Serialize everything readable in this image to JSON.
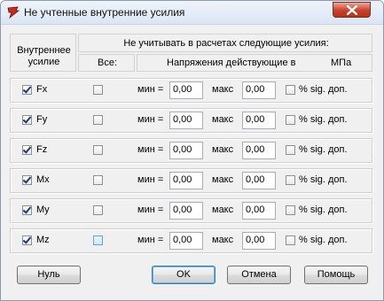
{
  "window": {
    "title": "Не учтенные внутренние усилия"
  },
  "header": {
    "internal_forces": "Внутреннее усилие",
    "ignore_title": "Не учитывать в расчетах следующие усилия:",
    "all": "Все:",
    "stresses": "Напряжения действующие в",
    "units": "МПа"
  },
  "rows": [
    {
      "name": "Fx",
      "checked": true,
      "all": false,
      "min_label": "мин =",
      "min": "0,00",
      "max_label": "макс",
      "max": "0,00",
      "pct_label": "% sig. доп."
    },
    {
      "name": "Fy",
      "checked": true,
      "all": false,
      "min_label": "мин =",
      "min": "0,00",
      "max_label": "макс",
      "max": "0,00",
      "pct_label": "% sig. доп."
    },
    {
      "name": "Fz",
      "checked": true,
      "all": false,
      "min_label": "мин =",
      "min": "0,00",
      "max_label": "макс",
      "max": "0,00",
      "pct_label": "% sig. доп."
    },
    {
      "name": "Mx",
      "checked": true,
      "all": false,
      "min_label": "мин =",
      "min": "0,00",
      "max_label": "макс",
      "max": "0,00",
      "pct_label": "% sig. доп."
    },
    {
      "name": "My",
      "checked": true,
      "all": false,
      "min_label": "мин =",
      "min": "0,00",
      "max_label": "макс",
      "max": "0,00",
      "pct_label": "% sig. доп."
    },
    {
      "name": "Mz",
      "checked": true,
      "all": false,
      "min_label": "мин =",
      "min": "0,00",
      "max_label": "макс",
      "max": "0,00",
      "pct_label": "% sig. доп."
    }
  ],
  "buttons": {
    "null": "Нуль",
    "ok": "OK",
    "cancel": "Отмена",
    "help": "Помощь"
  },
  "colors": {
    "close_button": "#c7412b",
    "check_mark": "#1f3c7a"
  }
}
